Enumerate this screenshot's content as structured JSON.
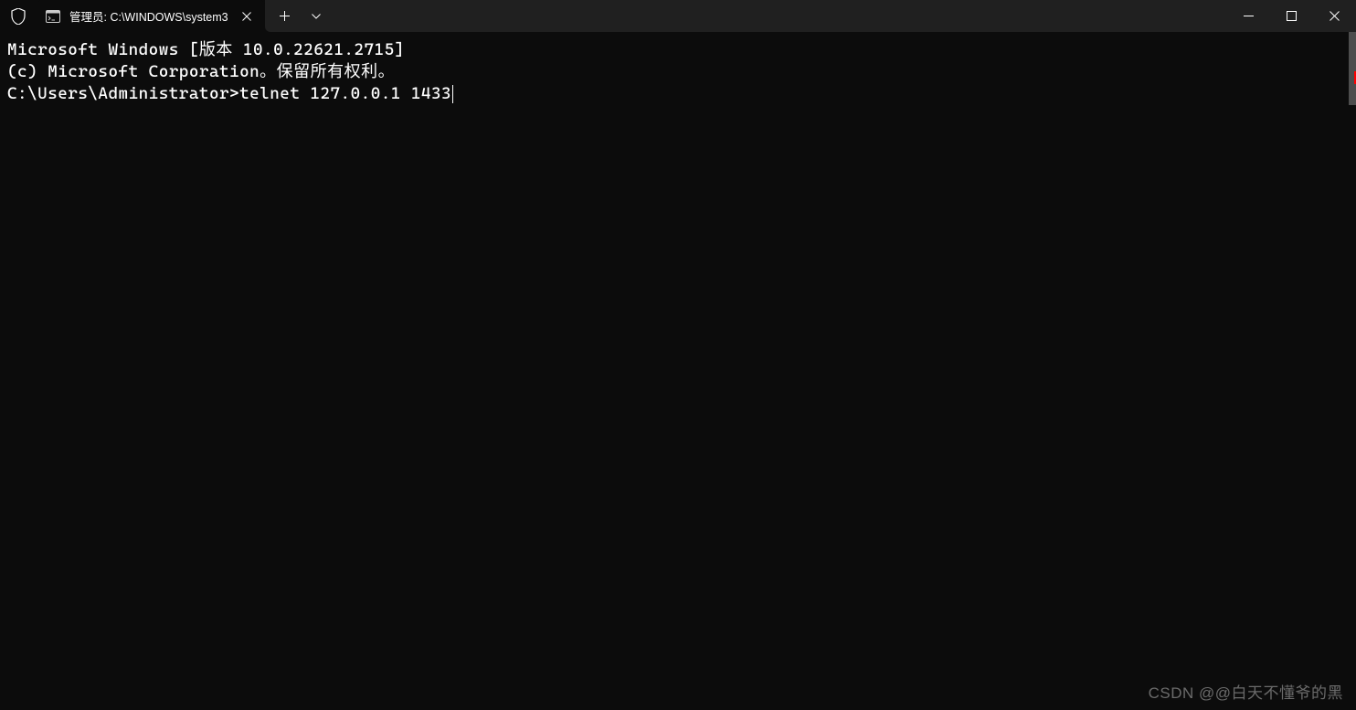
{
  "titlebar": {
    "tab": {
      "title": "管理员: C:\\WINDOWS\\system3"
    }
  },
  "terminal": {
    "line1": "Microsoft Windows [版本 10.0.22621.2715]",
    "line2": "(c) Microsoft Corporation。保留所有权利。",
    "blank": "",
    "prompt": "C:\\Users\\Administrator>",
    "command": "telnet 127.0.0.1 1433"
  },
  "watermark": "CSDN @@白天不懂爷的黑"
}
